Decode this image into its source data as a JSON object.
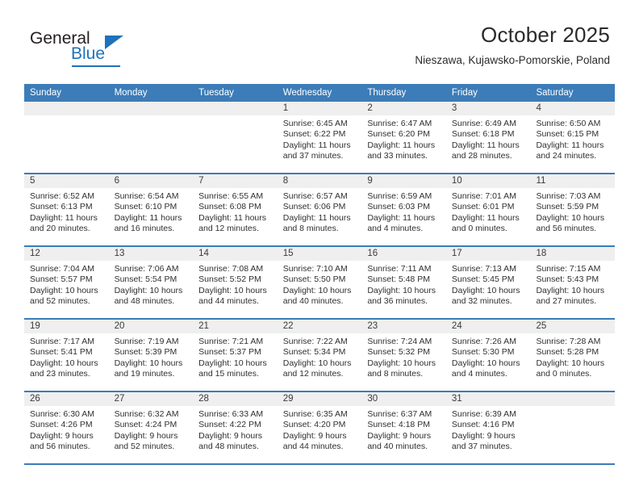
{
  "brand": {
    "name_part1": "General",
    "name_part2": "Blue"
  },
  "header": {
    "title": "October 2025",
    "subtitle": "Nieszawa, Kujawsko-Pomorskie, Poland"
  },
  "calendar": {
    "weekdays": [
      "Sunday",
      "Monday",
      "Tuesday",
      "Wednesday",
      "Thursday",
      "Friday",
      "Saturday"
    ],
    "accent_color": "#3c7cb8",
    "day_band_color": "#efefef",
    "weeks": [
      [
        {
          "day": ""
        },
        {
          "day": ""
        },
        {
          "day": ""
        },
        {
          "day": "1",
          "sunrise": "Sunrise: 6:45 AM",
          "sunset": "Sunset: 6:22 PM",
          "daylight": "Daylight: 11 hours and 37 minutes."
        },
        {
          "day": "2",
          "sunrise": "Sunrise: 6:47 AM",
          "sunset": "Sunset: 6:20 PM",
          "daylight": "Daylight: 11 hours and 33 minutes."
        },
        {
          "day": "3",
          "sunrise": "Sunrise: 6:49 AM",
          "sunset": "Sunset: 6:18 PM",
          "daylight": "Daylight: 11 hours and 28 minutes."
        },
        {
          "day": "4",
          "sunrise": "Sunrise: 6:50 AM",
          "sunset": "Sunset: 6:15 PM",
          "daylight": "Daylight: 11 hours and 24 minutes."
        }
      ],
      [
        {
          "day": "5",
          "sunrise": "Sunrise: 6:52 AM",
          "sunset": "Sunset: 6:13 PM",
          "daylight": "Daylight: 11 hours and 20 minutes."
        },
        {
          "day": "6",
          "sunrise": "Sunrise: 6:54 AM",
          "sunset": "Sunset: 6:10 PM",
          "daylight": "Daylight: 11 hours and 16 minutes."
        },
        {
          "day": "7",
          "sunrise": "Sunrise: 6:55 AM",
          "sunset": "Sunset: 6:08 PM",
          "daylight": "Daylight: 11 hours and 12 minutes."
        },
        {
          "day": "8",
          "sunrise": "Sunrise: 6:57 AM",
          "sunset": "Sunset: 6:06 PM",
          "daylight": "Daylight: 11 hours and 8 minutes."
        },
        {
          "day": "9",
          "sunrise": "Sunrise: 6:59 AM",
          "sunset": "Sunset: 6:03 PM",
          "daylight": "Daylight: 11 hours and 4 minutes."
        },
        {
          "day": "10",
          "sunrise": "Sunrise: 7:01 AM",
          "sunset": "Sunset: 6:01 PM",
          "daylight": "Daylight: 11 hours and 0 minutes."
        },
        {
          "day": "11",
          "sunrise": "Sunrise: 7:03 AM",
          "sunset": "Sunset: 5:59 PM",
          "daylight": "Daylight: 10 hours and 56 minutes."
        }
      ],
      [
        {
          "day": "12",
          "sunrise": "Sunrise: 7:04 AM",
          "sunset": "Sunset: 5:57 PM",
          "daylight": "Daylight: 10 hours and 52 minutes."
        },
        {
          "day": "13",
          "sunrise": "Sunrise: 7:06 AM",
          "sunset": "Sunset: 5:54 PM",
          "daylight": "Daylight: 10 hours and 48 minutes."
        },
        {
          "day": "14",
          "sunrise": "Sunrise: 7:08 AM",
          "sunset": "Sunset: 5:52 PM",
          "daylight": "Daylight: 10 hours and 44 minutes."
        },
        {
          "day": "15",
          "sunrise": "Sunrise: 7:10 AM",
          "sunset": "Sunset: 5:50 PM",
          "daylight": "Daylight: 10 hours and 40 minutes."
        },
        {
          "day": "16",
          "sunrise": "Sunrise: 7:11 AM",
          "sunset": "Sunset: 5:48 PM",
          "daylight": "Daylight: 10 hours and 36 minutes."
        },
        {
          "day": "17",
          "sunrise": "Sunrise: 7:13 AM",
          "sunset": "Sunset: 5:45 PM",
          "daylight": "Daylight: 10 hours and 32 minutes."
        },
        {
          "day": "18",
          "sunrise": "Sunrise: 7:15 AM",
          "sunset": "Sunset: 5:43 PM",
          "daylight": "Daylight: 10 hours and 27 minutes."
        }
      ],
      [
        {
          "day": "19",
          "sunrise": "Sunrise: 7:17 AM",
          "sunset": "Sunset: 5:41 PM",
          "daylight": "Daylight: 10 hours and 23 minutes."
        },
        {
          "day": "20",
          "sunrise": "Sunrise: 7:19 AM",
          "sunset": "Sunset: 5:39 PM",
          "daylight": "Daylight: 10 hours and 19 minutes."
        },
        {
          "day": "21",
          "sunrise": "Sunrise: 7:21 AM",
          "sunset": "Sunset: 5:37 PM",
          "daylight": "Daylight: 10 hours and 15 minutes."
        },
        {
          "day": "22",
          "sunrise": "Sunrise: 7:22 AM",
          "sunset": "Sunset: 5:34 PM",
          "daylight": "Daylight: 10 hours and 12 minutes."
        },
        {
          "day": "23",
          "sunrise": "Sunrise: 7:24 AM",
          "sunset": "Sunset: 5:32 PM",
          "daylight": "Daylight: 10 hours and 8 minutes."
        },
        {
          "day": "24",
          "sunrise": "Sunrise: 7:26 AM",
          "sunset": "Sunset: 5:30 PM",
          "daylight": "Daylight: 10 hours and 4 minutes."
        },
        {
          "day": "25",
          "sunrise": "Sunrise: 7:28 AM",
          "sunset": "Sunset: 5:28 PM",
          "daylight": "Daylight: 10 hours and 0 minutes."
        }
      ],
      [
        {
          "day": "26",
          "sunrise": "Sunrise: 6:30 AM",
          "sunset": "Sunset: 4:26 PM",
          "daylight": "Daylight: 9 hours and 56 minutes."
        },
        {
          "day": "27",
          "sunrise": "Sunrise: 6:32 AM",
          "sunset": "Sunset: 4:24 PM",
          "daylight": "Daylight: 9 hours and 52 minutes."
        },
        {
          "day": "28",
          "sunrise": "Sunrise: 6:33 AM",
          "sunset": "Sunset: 4:22 PM",
          "daylight": "Daylight: 9 hours and 48 minutes."
        },
        {
          "day": "29",
          "sunrise": "Sunrise: 6:35 AM",
          "sunset": "Sunset: 4:20 PM",
          "daylight": "Daylight: 9 hours and 44 minutes."
        },
        {
          "day": "30",
          "sunrise": "Sunrise: 6:37 AM",
          "sunset": "Sunset: 4:18 PM",
          "daylight": "Daylight: 9 hours and 40 minutes."
        },
        {
          "day": "31",
          "sunrise": "Sunrise: 6:39 AM",
          "sunset": "Sunset: 4:16 PM",
          "daylight": "Daylight: 9 hours and 37 minutes."
        },
        {
          "day": ""
        }
      ]
    ]
  }
}
